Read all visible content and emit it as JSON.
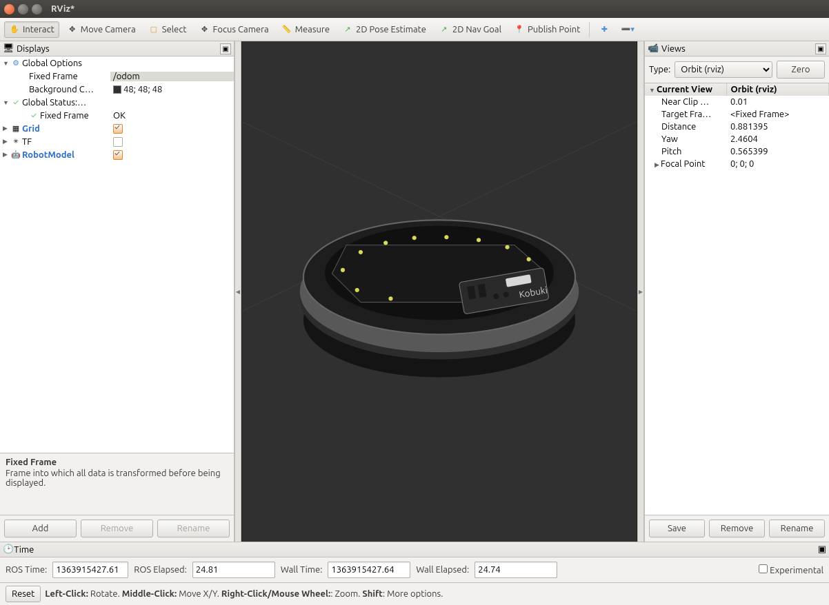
{
  "window": {
    "title": "RViz*"
  },
  "toolbar": {
    "interact": "Interact",
    "move_camera": "Move Camera",
    "select": "Select",
    "focus_camera": "Focus Camera",
    "measure": "Measure",
    "pose_estimate": "2D Pose Estimate",
    "nav_goal": "2D Nav Goal",
    "publish_point": "Publish Point"
  },
  "displays": {
    "title": "Displays",
    "global_options": "Global Options",
    "fixed_frame_label": "Fixed Frame",
    "fixed_frame_value": "/odom",
    "bg_label": "Background C…",
    "bg_value": "48; 48; 48",
    "global_status": "Global Status:…",
    "fixed_frame_status_label": "Fixed Frame",
    "fixed_frame_status_value": "OK",
    "grid": "Grid",
    "tf": "TF",
    "robot_model": "RobotModel",
    "help_title": "Fixed Frame",
    "help_text": "Frame into which all data is transformed before being displayed.",
    "add": "Add",
    "remove": "Remove",
    "rename": "Rename"
  },
  "views": {
    "title": "Views",
    "type_label": "Type:",
    "type_value": "Orbit (rviz)",
    "zero": "Zero",
    "header_current": "Current View",
    "header_type": "Orbit (rviz)",
    "near_clip_label": "Near Clip …",
    "near_clip_value": "0.01",
    "target_frame_label": "Target Fra…",
    "target_frame_value": "<Fixed Frame>",
    "distance_label": "Distance",
    "distance_value": "0.881395",
    "yaw_label": "Yaw",
    "yaw_value": "2.4604",
    "pitch_label": "Pitch",
    "pitch_value": "0.565399",
    "focal_label": "Focal Point",
    "focal_value": "0; 0; 0",
    "save": "Save",
    "remove": "Remove",
    "rename": "Rename"
  },
  "time": {
    "title": "Time",
    "ros_time_label": "ROS Time:",
    "ros_time_value": "1363915427.61",
    "ros_elapsed_label": "ROS Elapsed:",
    "ros_elapsed_value": "24.81",
    "wall_time_label": "Wall Time:",
    "wall_time_value": "1363915427.64",
    "wall_elapsed_label": "Wall Elapsed:",
    "wall_elapsed_value": "24.74",
    "experimental": "Experimental",
    "reset": "Reset",
    "hint_lc": "Left-Click:",
    "hint_lc_t": " Rotate. ",
    "hint_mc": "Middle-Click:",
    "hint_mc_t": " Move X/Y. ",
    "hint_rc": "Right-Click/Mouse Wheel:",
    "hint_rc_t": ": Zoom. ",
    "hint_sh": "Shift",
    "hint_sh_t": ": More options."
  }
}
